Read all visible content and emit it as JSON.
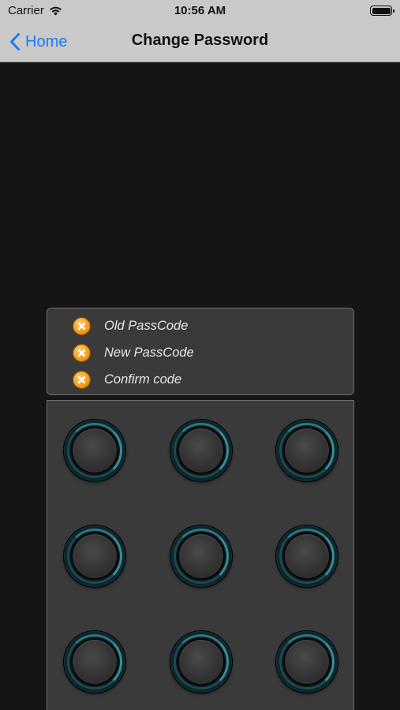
{
  "status_bar": {
    "carrier": "Carrier",
    "time": "10:56 AM"
  },
  "nav": {
    "back_label": "Home",
    "title": "Change Password"
  },
  "status_panel": {
    "items": [
      {
        "label": "Old PassCode",
        "icon": "x-circle-icon",
        "state": "incomplete"
      },
      {
        "label": "New PassCode",
        "icon": "x-circle-icon",
        "state": "incomplete"
      },
      {
        "label": "Confirm code",
        "icon": "x-circle-icon",
        "state": "incomplete"
      }
    ]
  },
  "keypad": {
    "rows": 3,
    "columns": 3,
    "buttons": 9
  },
  "colors": {
    "accent": "#1a7cf5",
    "status_icon": "#f59a1a",
    "background": "#151515",
    "panel": "#3a3a3a"
  }
}
